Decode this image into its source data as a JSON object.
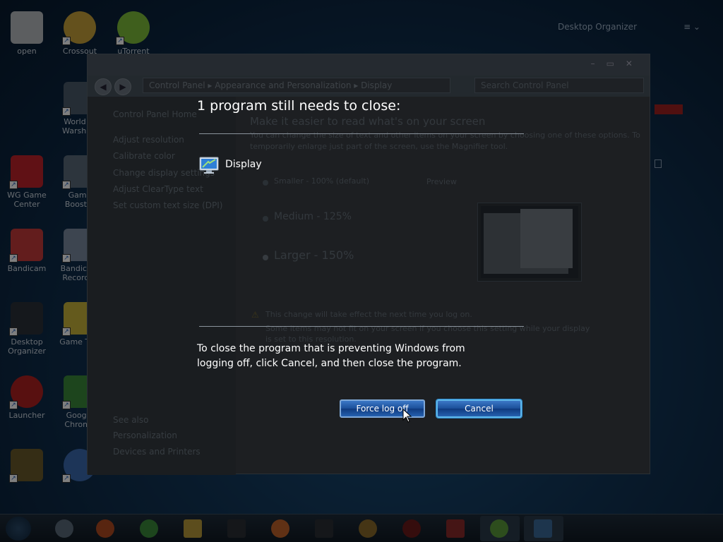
{
  "desktop": {
    "icons": [
      {
        "label": "open"
      },
      {
        "label": "Crossout"
      },
      {
        "label": "uTorrent"
      },
      {
        "label": "World of Warships"
      },
      {
        "label": "WG Game Center"
      },
      {
        "label": "Game Booster"
      },
      {
        "label": "Bandicam"
      },
      {
        "label": "Bandicam Recorder"
      },
      {
        "label": "Desktop Organizer"
      },
      {
        "label": "Game Tool"
      },
      {
        "label": "Launcher"
      },
      {
        "label": "Google Chrome"
      }
    ],
    "gadget": {
      "title": "Desktop Organizer",
      "menu": "≡ ⌄"
    }
  },
  "control_panel": {
    "address": "Control Panel ▸ Appearance and Personalization ▸ Display",
    "search_placeholder": "Search Control Panel",
    "sidebar": {
      "home": "Control Panel Home",
      "links": [
        "Adjust resolution",
        "Calibrate color",
        "Change display settings",
        "Adjust ClearType text",
        "Set custom text size (DPI)"
      ],
      "see_also_heading": "See also",
      "see_also": [
        "Personalization",
        "Devices and Printers"
      ]
    },
    "main": {
      "heading": "Make it easier to read what's on your screen",
      "intro_line1": "You can change the size of text and other items on your screen by choosing one of these options. To",
      "intro_line2": "temporarily enlarge just part of the screen, use the Magnifier tool.",
      "options": [
        "Smaller - 100% (default)",
        "Medium - 125%",
        "Larger - 150%"
      ],
      "preview_label": "Preview",
      "warning": "This change will take effect the next time you log on.",
      "note_line1": "Some items may not fit on your screen if you choose this setting while your display",
      "note_line2": "is set to this resolution."
    }
  },
  "logoff_prompt": {
    "title": "1 program still needs to close:",
    "program": "Display",
    "message": "To close the program that is preventing Windows from logging off, click Cancel, and then close the program.",
    "buttons": {
      "force": "Force log off",
      "cancel": "Cancel"
    }
  },
  "colors": {
    "button_blue": "#1b4e99",
    "text_white": "#ffffff"
  }
}
